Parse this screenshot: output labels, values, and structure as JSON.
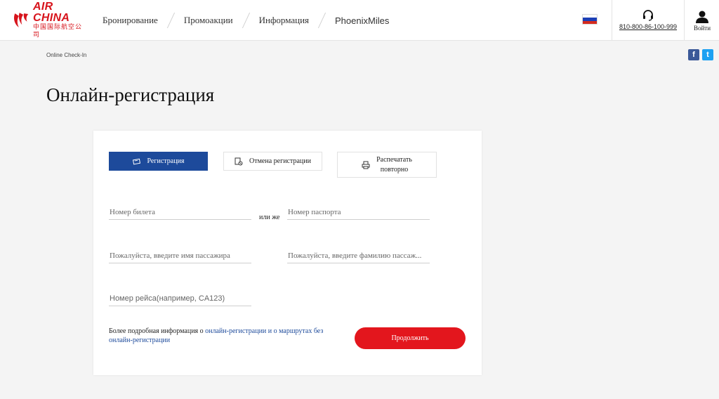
{
  "header": {
    "logo_en": "AIR CHINA",
    "logo_cn": "中国国际航空公司",
    "nav": [
      {
        "label": "Бронирование"
      },
      {
        "label": "Промоакции"
      },
      {
        "label": "Информация"
      },
      {
        "label": "PhoenixMiles"
      }
    ],
    "flag": "ru-flag",
    "phone": "810-800-86-100-999",
    "login_label": "Войти"
  },
  "breadcrumb": "Online Check-In",
  "social": {
    "facebook": "f",
    "twitter": "t"
  },
  "page_title": "Онлайн-регистрация",
  "tabs": {
    "checkin": "Регистрация",
    "cancel": "Отмена регистрации",
    "print_line1": "Распечатать",
    "print_line2": "повторно"
  },
  "form": {
    "ticket_placeholder": "Номер билета",
    "or_label": "или же",
    "passport_placeholder": "Номер паспорта",
    "first_name_placeholder": "Пожалуйста, введите имя пассажира",
    "last_name_placeholder": "Пожалуйста, введите фамилию пассаж...",
    "flight_placeholder": "Номер рейса(например, CA123)"
  },
  "info": {
    "prefix": "Более подробная информация о ",
    "link": "онлайн-регистрации и о маршрутах без онлайн-регистрации"
  },
  "continue_label": "Продолжить",
  "colors": {
    "brand_red": "#e3161d",
    "brand_blue": "#1d4a9b"
  }
}
